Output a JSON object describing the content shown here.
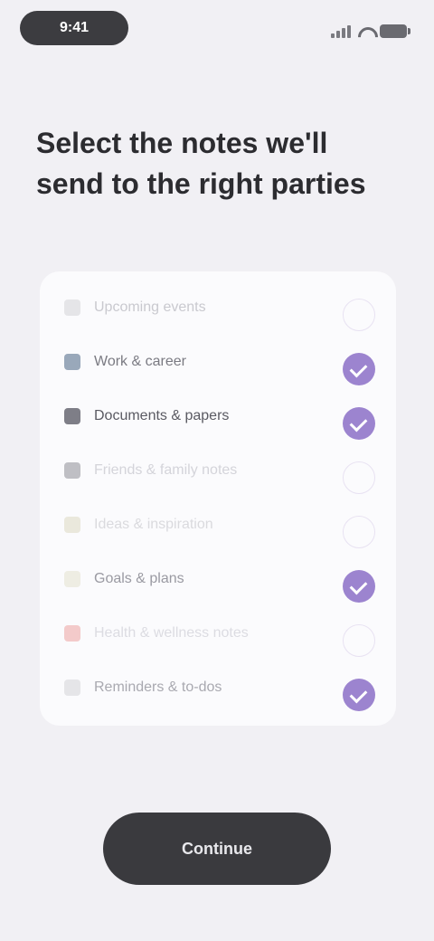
{
  "status_bar": {
    "time": "9:41"
  },
  "heading": "Select the notes we'll send to the right parties",
  "rows": [
    {
      "icon": "calendar-icon",
      "label": "Upcoming events",
      "checked": false,
      "icon_color": "#e2e2e6",
      "text_color": "#c9c9cf"
    },
    {
      "icon": "briefcase-icon",
      "label": "Work & career",
      "checked": true,
      "icon_color": "#8e9eb2",
      "text_color": "#7a7a82"
    },
    {
      "icon": "document-icon",
      "label": "Documents & papers",
      "checked": true,
      "icon_color": "#70707a",
      "text_color": "#5a5a62"
    },
    {
      "icon": "people-icon",
      "label": "Friends & family notes",
      "checked": false,
      "icon_color": "#b8b8be",
      "text_color": "#d4d4da"
    },
    {
      "icon": "star-icon",
      "label": "Ideas & inspiration",
      "checked": false,
      "icon_color": "#e8e6d8",
      "text_color": "#dadade"
    },
    {
      "icon": "lightbulb-icon",
      "label": "Goals & plans",
      "checked": true,
      "icon_color": "#ecebe0",
      "text_color": "#9a9aa2"
    },
    {
      "icon": "heart-icon",
      "label": "Health & wellness notes",
      "checked": false,
      "icon_color": "#f2c4c4",
      "text_color": "#dcdce2"
    },
    {
      "icon": "note-icon",
      "label": "Reminders & to-dos",
      "checked": true,
      "icon_color": "#e2e2e6",
      "text_color": "#a9a9b0"
    }
  ],
  "cta_label": "Continue",
  "colors": {
    "accent": "#9c84cf",
    "button": "#3a3a3e",
    "background": "#f1f0f4"
  }
}
